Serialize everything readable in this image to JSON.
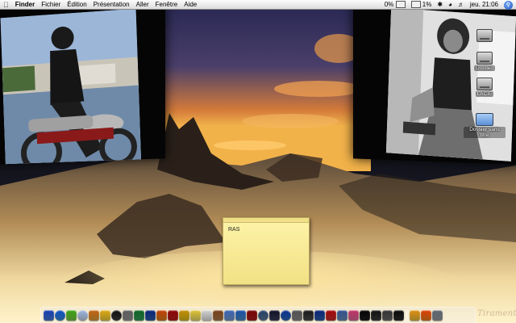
{
  "menubar": {
    "apple_icon": "apple-icon",
    "items": [
      "Finder",
      "Fichier",
      "Édition",
      "Présentation",
      "Aller",
      "Fenêtre",
      "Aide"
    ],
    "status": {
      "cpu": "0%",
      "battery": "1%",
      "clock": "jeu. 21:06"
    }
  },
  "desktop": {
    "icons": [
      {
        "label": "",
        "kind": "disk"
      },
      {
        "label": "Untitled",
        "kind": "disk"
      },
      {
        "label": "LACIE",
        "kind": "disk"
      },
      {
        "label": "Dossier sans titre",
        "kind": "folder"
      }
    ]
  },
  "sticky": {
    "text": "RAS"
  },
  "dock": {
    "items": [
      {
        "name": "finder-icon",
        "color": "#4a7fd8"
      },
      {
        "name": "safari-icon",
        "color": "#3a8fe0"
      },
      {
        "name": "ichat-icon",
        "color": "#7ccd4a"
      },
      {
        "name": "itunes-icon",
        "color": "#c8d8f0"
      },
      {
        "name": "imovie-icon",
        "color": "#e0a040"
      },
      {
        "name": "duck-icon",
        "color": "#f0d040"
      },
      {
        "name": "dashboard-icon",
        "color": "#404040"
      },
      {
        "name": "system-preferences-icon",
        "color": "#9a9a9a"
      },
      {
        "name": "dreamweaver-icon",
        "color": "#3aa060"
      },
      {
        "name": "photoshop-icon",
        "color": "#3060b0"
      },
      {
        "name": "illustrator-icon",
        "color": "#e08020"
      },
      {
        "name": "flash-icon",
        "color": "#c02020"
      },
      {
        "name": "fireworks-icon",
        "color": "#e0c020"
      },
      {
        "name": "stickies-icon",
        "color": "#f0e070"
      },
      {
        "name": "textedit-icon",
        "color": "#e8e8e8"
      },
      {
        "name": "address-book-icon",
        "color": "#b08050"
      },
      {
        "name": "mail-icon",
        "color": "#7aa0d8"
      },
      {
        "name": "iphoto-icon",
        "color": "#5090d0"
      },
      {
        "name": "acrobat-icon",
        "color": "#b02020"
      },
      {
        "name": "network-icon",
        "color": "#6080a0"
      },
      {
        "name": "radio-icon",
        "color": "#404060"
      },
      {
        "name": "globe-icon",
        "color": "#3070c0"
      },
      {
        "name": "utilities-icon",
        "color": "#909090"
      },
      {
        "name": "pen-icon",
        "color": "#505050"
      },
      {
        "name": "app-store-icon",
        "color": "#3060b0"
      },
      {
        "name": "calendar-icon",
        "color": "#d03030"
      },
      {
        "name": "preview-icon",
        "color": "#7090c0"
      },
      {
        "name": "color-icon",
        "color": "#e070a0"
      },
      {
        "name": "terminal-icon",
        "color": "#202020"
      },
      {
        "name": "monitor-icon",
        "color": "#404040"
      },
      {
        "name": "archive-icon",
        "color": "#707070"
      },
      {
        "name": "spider-icon",
        "color": "#303030"
      },
      {
        "name": "sun-icon",
        "color": "#f0c040"
      },
      {
        "name": "vlc-icon",
        "color": "#f08020"
      },
      {
        "name": "trash-icon",
        "color": "#9aa0a8"
      }
    ]
  },
  "signature": "Tiramente"
}
